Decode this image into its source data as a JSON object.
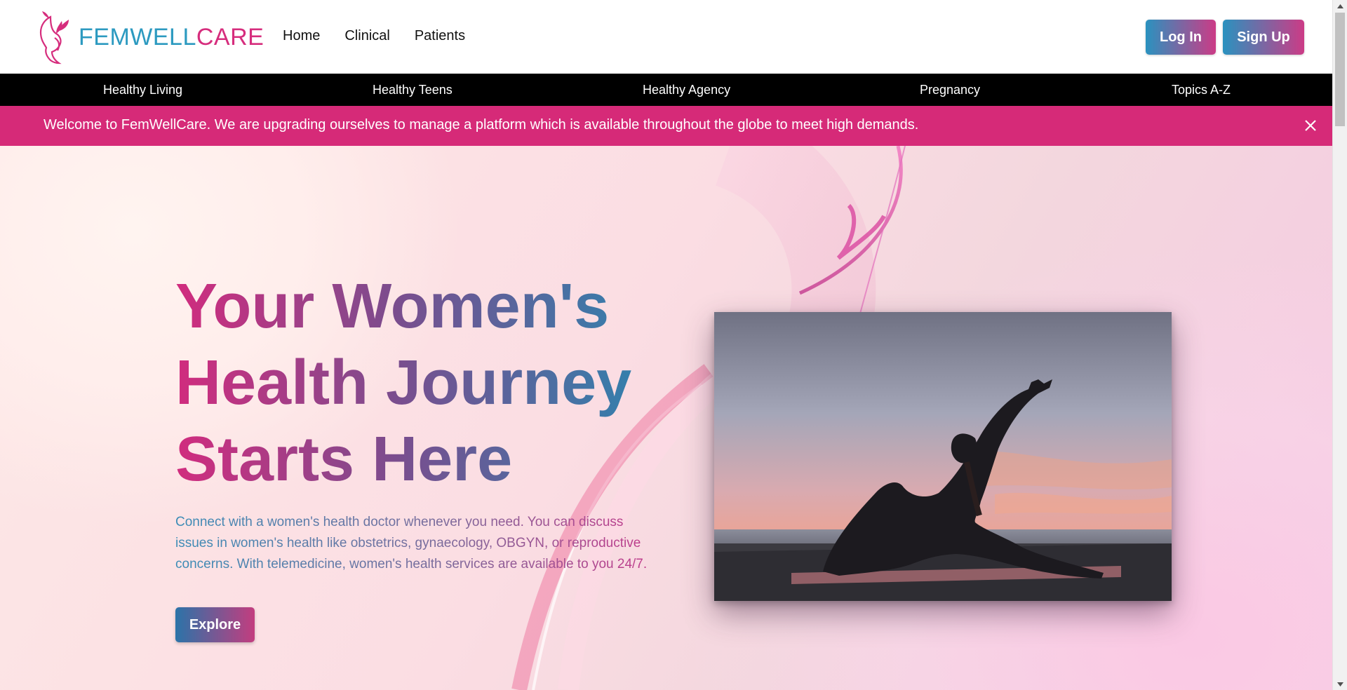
{
  "brand": {
    "part1": "FEMWELL",
    "part2": "CARE"
  },
  "top_nav": [
    "Home",
    "Clinical",
    "Patients"
  ],
  "auth": {
    "login": "Log In",
    "signup": "Sign Up"
  },
  "categories": [
    "Healthy Living",
    "Healthy Teens",
    "Healthy Agency",
    "Pregnancy",
    "Topics A-Z"
  ],
  "announcement": "Welcome to FemWellCare. We are upgrading ourselves to manage a platform which is available throughout the globe to meet high demands.",
  "hero": {
    "title_line1": "Your Women's",
    "title_line2": "Health Journey",
    "title_line3": "Starts Here",
    "description": "Connect with a women's health doctor whenever you need. You can discuss issues in women's health like obstetrics, gynaecology, OBGYN, or reproductive concerns. With telemedicine, women's health services are available to you 24/7.",
    "button": "Explore"
  },
  "colors": {
    "brand_blue": "#2c9ac0",
    "brand_pink": "#d62d7d",
    "banner": "#d62a78",
    "catbar": "#000000"
  },
  "icons": {
    "logo": "woman-silhouette-leaf-logo",
    "close": "close-icon",
    "photo": "yoga-pose-sunset-photo"
  }
}
